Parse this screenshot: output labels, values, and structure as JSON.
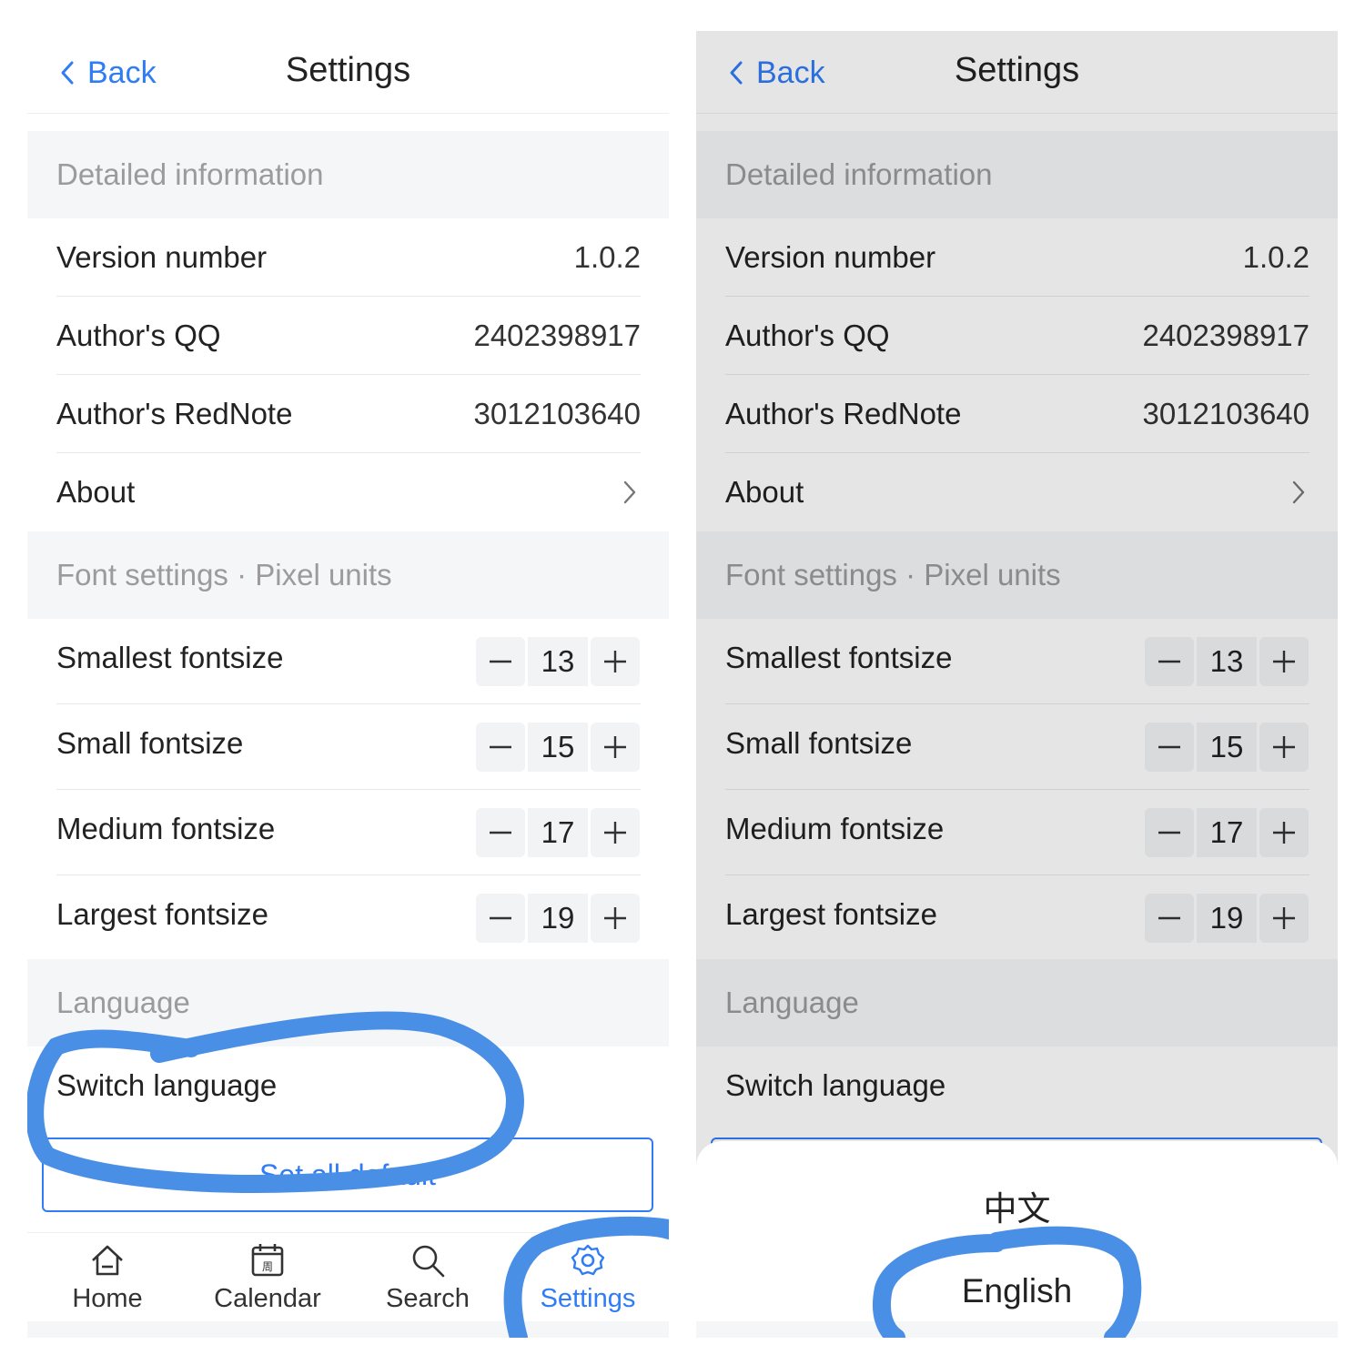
{
  "settings_page": {
    "back_label": "Back",
    "title": "Settings",
    "detail_section_title": "Detailed information",
    "info_rows": [
      {
        "label": "Version number",
        "value": "1.0.2"
      },
      {
        "label": "Author's QQ",
        "value": "2402398917"
      },
      {
        "label": "Author's RedNote",
        "value": "3012103640"
      }
    ],
    "about_label": "About",
    "font_section_title": "Font settings · Pixel units",
    "font_rows": [
      {
        "label": "Smallest fontsize",
        "value": "13"
      },
      {
        "label": "Small fontsize",
        "value": "15"
      },
      {
        "label": "Medium fontsize",
        "value": "17"
      },
      {
        "label": "Largest fontsize",
        "value": "19"
      }
    ],
    "language_section_title": "Language",
    "switch_language_label": "Switch language",
    "set_default_label": "Set all default"
  },
  "tabbar": {
    "items": [
      {
        "label": "Home",
        "icon": "home-icon"
      },
      {
        "label": "Calendar",
        "icon": "calendar-icon",
        "icon_text": "周"
      },
      {
        "label": "Search",
        "icon": "search-icon"
      },
      {
        "label": "Settings",
        "icon": "gear-icon"
      }
    ],
    "active": "Settings"
  },
  "language_sheet": {
    "options": [
      "中文",
      "English"
    ]
  },
  "colors": {
    "accent": "#2f7cf6",
    "annotation": "#4a8fe6",
    "section_bg": "#f5f6f8",
    "muted_text": "#9b9b9b"
  }
}
